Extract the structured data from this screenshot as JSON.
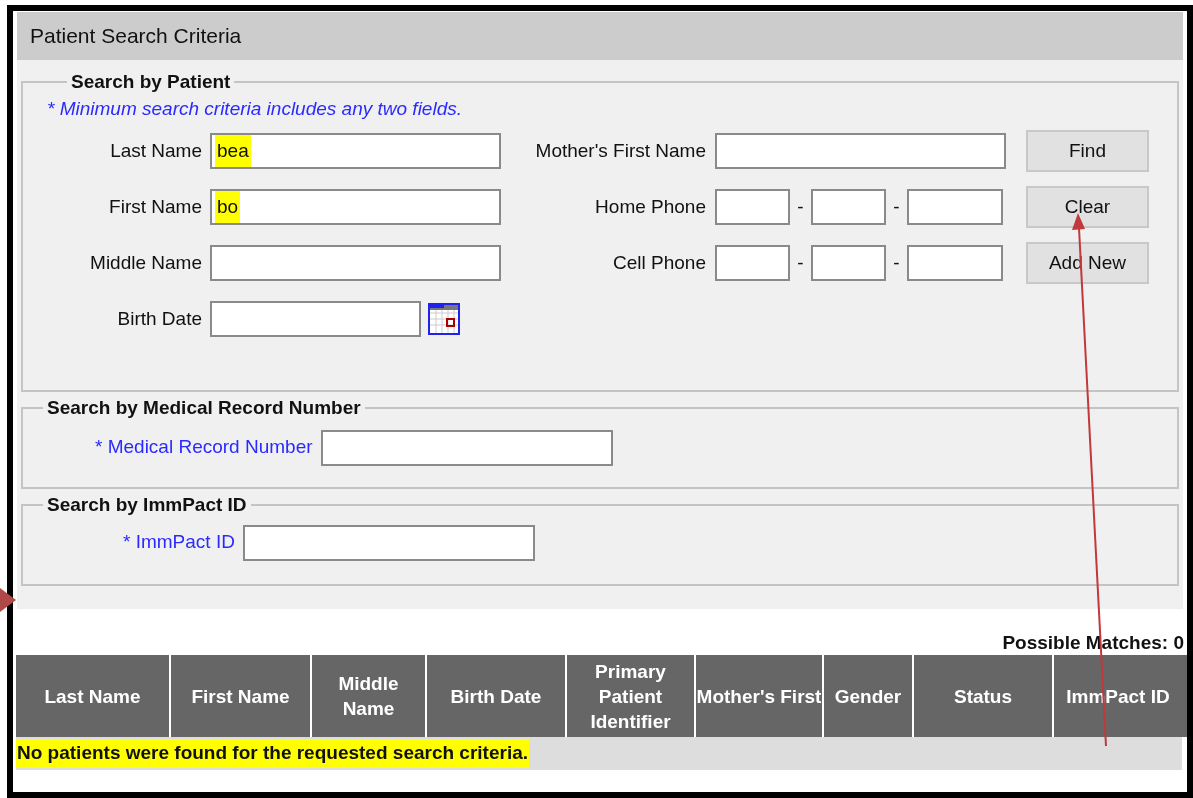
{
  "panel": {
    "title": "Patient Search Criteria"
  },
  "patient_section": {
    "legend": "Search by Patient",
    "note": "* Minimum search criteria includes any two fields.",
    "left_fields": [
      {
        "label": "Last Name",
        "kind": "text",
        "value": "bea",
        "highlighted": true
      },
      {
        "label": "First Name",
        "kind": "text",
        "value": "bo",
        "highlighted": true
      },
      {
        "label": "Middle Name",
        "kind": "text"
      },
      {
        "label": "Birth Date",
        "kind": "date"
      }
    ],
    "right_fields": [
      {
        "label": "Mother's First Name",
        "kind": "text"
      },
      {
        "label": "Home Phone",
        "kind": "phone",
        "separators": [
          "-",
          "-"
        ]
      },
      {
        "label": "Cell Phone",
        "kind": "phone",
        "separators": [
          "-",
          "-"
        ]
      }
    ],
    "buttons": [
      "Find",
      "Clear",
      "Add New"
    ]
  },
  "mrn_section": {
    "legend": "Search by Medical Record Number",
    "label": "* Medical Record Number"
  },
  "immpact_section": {
    "legend": "Search by ImmPact ID",
    "label": "* ImmPact ID"
  },
  "results": {
    "count": "Possible Matches: 0",
    "columns": [
      "Last Name",
      "First Name",
      "Middle Name",
      "Birth Date",
      "Primary Patient Identifier",
      "Mother's First",
      "Gender",
      "Status",
      "ImmPact ID"
    ],
    "message": "No patients were found for the requested search criteria.",
    "message_highlighted": true
  }
}
